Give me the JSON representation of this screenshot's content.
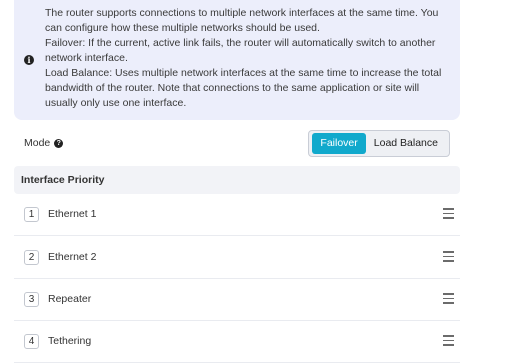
{
  "info": {
    "icon": "info-circle-icon",
    "lines": [
      "The router supports connections to multiple network interfaces at the same time. You can configure how these multiple networks should be used.",
      "Failover: If the current, active link fails, the router will automatically switch to another network interface.",
      "Load Balance: Uses multiple network interfaces at the same time to increase the total bandwidth of the router. Note that connections to the same application or site will usually only use one interface."
    ]
  },
  "mode": {
    "label": "Mode",
    "help_icon": "question-circle-icon",
    "options": [
      "Failover",
      "Load Balance"
    ],
    "selected": "Failover",
    "accent_color": "#11a9cc"
  },
  "priority": {
    "header": "Interface Priority",
    "handle_icon": "drag-handle-icon",
    "items": [
      {
        "index": "1",
        "name": "Ethernet 1"
      },
      {
        "index": "2",
        "name": "Ethernet 2"
      },
      {
        "index": "3",
        "name": "Repeater"
      },
      {
        "index": "4",
        "name": "Tethering"
      }
    ]
  }
}
